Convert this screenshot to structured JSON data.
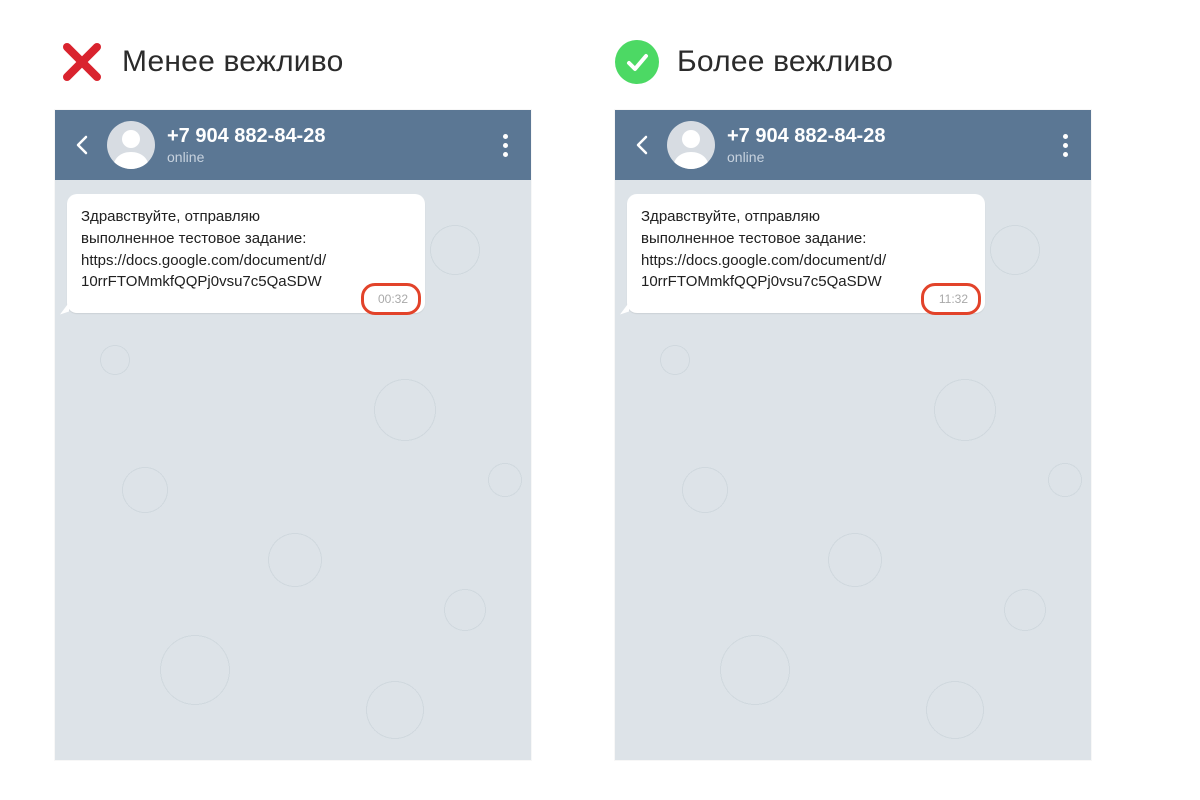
{
  "labels": {
    "less": "Менее вежливо",
    "more": "Более вежливо"
  },
  "chat": {
    "phone": "+7 904 882-84-28",
    "status": "online",
    "message": {
      "l1": "Здравствуйте, отправляю",
      "l2": "выполненное тестовое задание:",
      "l3": "https://docs.google.com/document/d/",
      "l4": "10rrFTOMmkfQQPj0vsu7c5QaSDW"
    }
  },
  "times": {
    "less": "00:32",
    "more": "11:32"
  }
}
